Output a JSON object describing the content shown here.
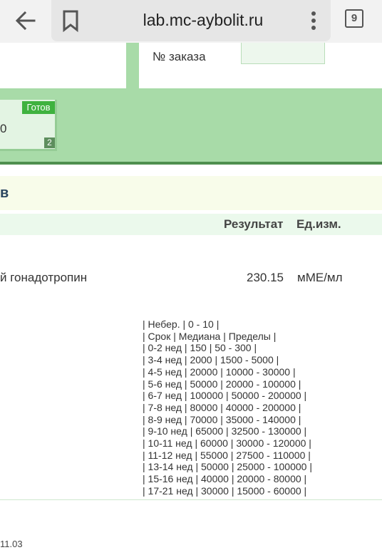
{
  "browser": {
    "url": "lab.mc-aybolit.ru",
    "tab_count": "9",
    "icons": [
      "back-arrow-icon",
      "bookmark-icon",
      "kebab-menu-icon",
      "tabs-icon"
    ]
  },
  "order": {
    "label": "№ заказа"
  },
  "card": {
    "badge": "Готов",
    "value": "0",
    "count": "2"
  },
  "section": {
    "title": "в"
  },
  "table": {
    "col_result": "Результат",
    "col_unit": "Ед.изм."
  },
  "test": {
    "name": "й гонадотропин",
    "value": "230.15",
    "unit": "мМЕ/мл",
    "reference_lines": [
      "| Небер. | 0 - 10 |",
      "| Срок | Медиана | Пределы |",
      "| 0-2 нед | 150 | 50 - 300 |",
      "| 3-4 нед | 2000 | 1500 - 5000 |",
      "| 4-5 нед | 20000 | 10000 - 30000 |",
      "| 5-6 нед | 50000 | 20000 - 100000 |",
      "| 6-7 нед | 100000 | 50000 - 200000 |",
      "| 7-8 нед | 80000 | 40000 - 200000 |",
      "| 8-9 нед | 70000 | 35000 - 140000 |",
      "| 9-10 нед | 65000 | 32500 - 130000 |",
      "| 10-11 нед | 60000 | 30000 - 120000 |",
      "| 11-12 нед | 55000 | 27500 - 110000 |",
      "| 13-14 нед | 50000 | 25000 - 100000 |",
      "| 15-16 нед | 40000 | 20000 - 80000 |",
      "| 17-21 нед | 30000 | 15000 - 60000 |"
    ]
  },
  "footer": {
    "date": "11.03"
  },
  "colors": {
    "green_band": "#a8dba8",
    "badge_green": "#3fb23f",
    "header_bg": "#f8fcea",
    "table_head_bg": "#ebf9ec"
  }
}
